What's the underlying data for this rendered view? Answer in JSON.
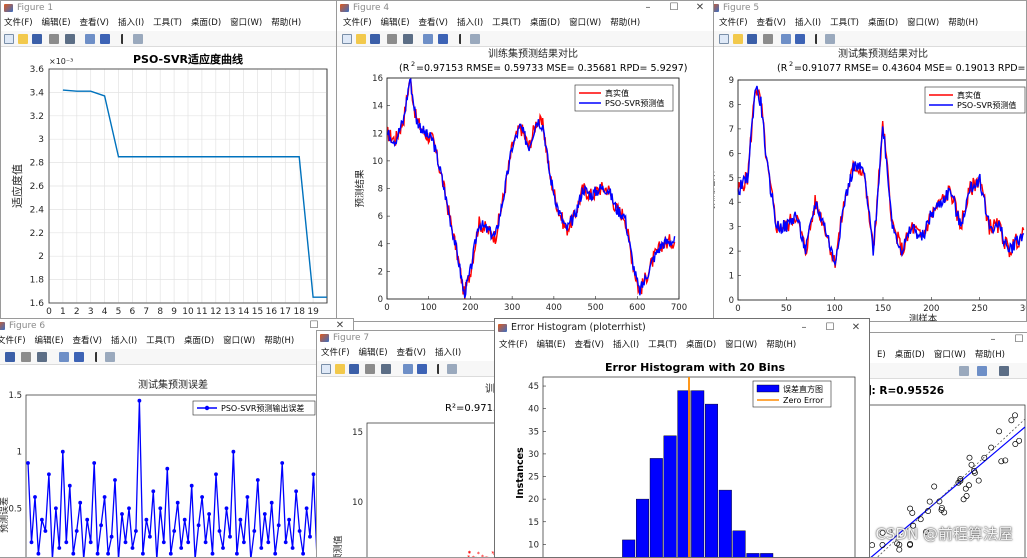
{
  "menus": {
    "full": [
      "文件(F)",
      "编辑(E)",
      "查看(V)",
      "插入(I)",
      "工具(T)",
      "桌面(D)",
      "窗口(W)",
      "帮助(H)"
    ],
    "cut_view": [
      "查看(V)",
      "插入(I)",
      "工具(T)",
      "桌面(D)",
      "窗口(W)",
      "帮助(H)"
    ],
    "cut_insert": [
      "插入(I)",
      "工具(T)",
      "桌面(D)",
      "窗口(W)",
      "帮助(H)"
    ],
    "cut_window": [
      "E)",
      "桌面(D)",
      "窗口(W)",
      "帮助(H)"
    ]
  },
  "win1": {
    "title": "Figure 1",
    "chart_data": {
      "type": "line",
      "title": "PSO-SVR适应度曲线",
      "ylabel": "适应度值",
      "exponent_label": "×10⁻³",
      "x": [
        1,
        2,
        3,
        4,
        5,
        6,
        7,
        8,
        9,
        10,
        11,
        12,
        13,
        14,
        15,
        16,
        17,
        18,
        19,
        20
      ],
      "values": [
        3.42,
        3.41,
        3.41,
        3.37,
        2.85,
        2.85,
        2.85,
        2.85,
        2.85,
        2.85,
        2.85,
        2.85,
        2.85,
        2.85,
        2.85,
        2.85,
        2.85,
        2.85,
        1.65,
        1.65
      ],
      "xlim": [
        0,
        20
      ],
      "ylim": [
        1.6,
        3.6
      ],
      "xticks": [
        "0",
        "1",
        "2",
        "3",
        "4",
        "5",
        "6",
        "7",
        "8",
        "9",
        "10",
        "11",
        "12",
        "13",
        "14",
        "15",
        "16",
        "17",
        "18",
        "19"
      ],
      "yticks": [
        "1.6",
        "1.8",
        "2",
        "2.2",
        "2.4",
        "2.6",
        "2.8",
        "3",
        "3.2",
        "3.4",
        "3.6"
      ],
      "color": "#0072bd",
      "grid": true
    }
  },
  "win4": {
    "title": "Figure 4",
    "chart_data": {
      "type": "line",
      "title": "训练集预测结果对比",
      "metrics": "=0.97153 RMSE= 0.59733 MSE= 0.35681 RPD= 5.9297)",
      "ylabel": "预测结果",
      "xlim": [
        0,
        700
      ],
      "ylim": [
        0,
        16
      ],
      "xticks": [
        "0",
        "100",
        "200",
        "300",
        "400",
        "500",
        "600",
        "700"
      ],
      "yticks": [
        "0",
        "2",
        "4",
        "6",
        "8",
        "10",
        "12",
        "14",
        "16"
      ],
      "series": [
        {
          "name": "真实值",
          "color": "#ff0000"
        },
        {
          "name": "PSO-SVR预测值",
          "color": "#0000ff"
        }
      ],
      "anchors_x": [
        0,
        20,
        40,
        55,
        70,
        90,
        110,
        130,
        150,
        170,
        185,
        200,
        220,
        240,
        260,
        280,
        300,
        320,
        340,
        360,
        375,
        390,
        410,
        430,
        450,
        470,
        490,
        510,
        530,
        550,
        570,
        590,
        605,
        620,
        640,
        660,
        680
      ],
      "anchors_y": [
        12,
        11.5,
        13,
        16,
        13,
        12,
        11.5,
        9,
        6,
        3,
        0.3,
        2,
        5.5,
        5,
        4.5,
        7.5,
        11,
        12.5,
        11,
        13,
        12.5,
        9,
        6.5,
        5,
        6,
        8,
        7.5,
        8,
        8,
        6.5,
        6,
        2.5,
        0.5,
        1.5,
        3,
        4,
        4.2
      ]
    }
  },
  "win5": {
    "title": "Figure 5",
    "chart_data": {
      "type": "line",
      "title": "测试集预测结果对比",
      "metrics": "=0.91077 RMSE= 0.43604 MSE= 0.19013 RPD= 3.3541)",
      "ylabel": "预测结果",
      "xlabel": "测样本",
      "xlim": [
        0,
        300
      ],
      "ylim": [
        0,
        9
      ],
      "xticks": [
        "0",
        "50",
        "100",
        "150",
        "200",
        "250",
        "300"
      ],
      "yticks": [
        "0",
        "1",
        "2",
        "3",
        "4",
        "5",
        "6",
        "7",
        "8",
        "9"
      ],
      "series": [
        {
          "name": "真实值",
          "color": "#ff0000"
        },
        {
          "name": "PSO-SVR预测值",
          "color": "#0000ff"
        }
      ],
      "anchors_x": [
        0,
        10,
        18,
        24,
        30,
        40,
        50,
        60,
        70,
        80,
        90,
        100,
        110,
        120,
        130,
        140,
        150,
        160,
        170,
        180,
        190,
        200,
        210,
        220,
        230,
        240,
        250,
        260,
        270,
        280,
        290,
        300
      ],
      "anchors_y": [
        4.5,
        5,
        8.8,
        8,
        5.5,
        3,
        3,
        3.5,
        2,
        4,
        3,
        1.5,
        4,
        5.5,
        5.3,
        2,
        7.2,
        3,
        2,
        3,
        2.5,
        3.5,
        4,
        4.5,
        3,
        4.5,
        5,
        3,
        3,
        2,
        2.5,
        2.8
      ]
    }
  },
  "win6": {
    "title": "Figure 6",
    "chart_data": {
      "type": "line",
      "title": "测试集预测误差",
      "ylabel": "预测误差",
      "ylim": [
        0,
        1.5
      ],
      "yticks": [
        "0",
        "0.5",
        "1",
        "1.5"
      ],
      "series": [
        {
          "name": "PSO-SVR预测输出误差",
          "color": "#0000ff"
        }
      ],
      "values": [
        0.9,
        0.2,
        0.6,
        0.1,
        0.4,
        0.3,
        0.8,
        0.05,
        0.5,
        0.15,
        1.0,
        0.2,
        0.7,
        0.1,
        0.3,
        0.55,
        0.05,
        0.4,
        0.2,
        0.9,
        0.1,
        0.35,
        0.6,
        0.1,
        0.25,
        0.75,
        0.05,
        0.45,
        0.2,
        0.5,
        0.15,
        0.3,
        1.45,
        0.1,
        0.4,
        0.25,
        0.65,
        0.05,
        0.5,
        0.2,
        0.85,
        0.1,
        0.3,
        0.55,
        0.15,
        0.4,
        0.2,
        0.7,
        0.05,
        0.35,
        0.6,
        0.2,
        0.45,
        0.1,
        0.8,
        0.3,
        0.15,
        0.5,
        0.25,
        1.0,
        0.1,
        0.4,
        0.2,
        0.6,
        0.05,
        0.3,
        0.75,
        0.15,
        0.45,
        0.2,
        0.55,
        0.1,
        0.35,
        0.9,
        0.2,
        0.4,
        0.15,
        0.65,
        0.3,
        0.1,
        0.5,
        0.25,
        0.8,
        0.05
      ]
    }
  },
  "win7": {
    "title": "Figure 7",
    "chart_data": {
      "type": "scatter",
      "title_fragment": "训",
      "metric": "R²=0.9715",
      "ylabel": "预测值",
      "yticks": [
        "10",
        "15"
      ]
    }
  },
  "winR": {
    "chart_data": {
      "type": "scatter",
      "title_fragment": "测: R=0.95526"
    }
  },
  "hist": {
    "title": "Error Histogram (ploterrhist)",
    "chart_data": {
      "type": "bar",
      "title": "Error Histogram with 20 Bins",
      "ylabel": "Instances",
      "ylim": [
        5,
        47
      ],
      "yticks": [
        "10",
        "15",
        "20",
        "25",
        "30",
        "35",
        "40",
        "45"
      ],
      "values": [
        2,
        4,
        6,
        11,
        20,
        29,
        34,
        44,
        44,
        41,
        22,
        13,
        8,
        8
      ],
      "series": [
        {
          "name": "误差直方图",
          "color": "#0000ff"
        },
        {
          "name": "Zero Error",
          "color": "#ff8c00"
        }
      ]
    }
  },
  "watermark": "CSDN @前程算法屋"
}
